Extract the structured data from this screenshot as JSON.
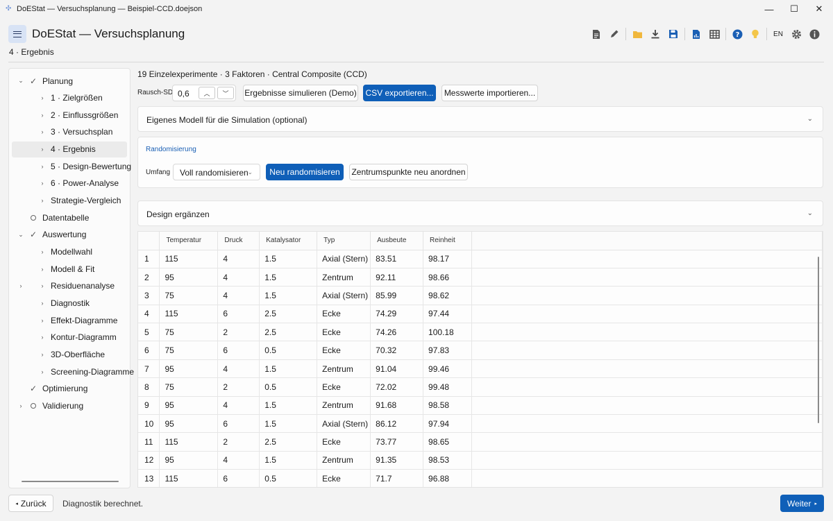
{
  "window": {
    "title": "DoEStat — Versuchsplanung — Beispiel-CCD.doejson",
    "minimize": "—",
    "maximize": "☐",
    "close": "✕"
  },
  "header": {
    "title": "DoEStat — Versuchsplanung",
    "lang": "EN",
    "breadcrumb": "4 · Ergebnis",
    "icons": [
      "document-icon",
      "edit-icon",
      "folder-icon",
      "download-icon",
      "save-icon",
      "report-icon",
      "table-icon",
      "help-icon",
      "lightbulb-icon",
      "settings-icon",
      "info-icon"
    ]
  },
  "sidebar": {
    "items": [
      {
        "label": "Planung",
        "level": 0,
        "state": "check",
        "expander": "⌄"
      },
      {
        "label": "1 · Zielgrößen",
        "level": 1
      },
      {
        "label": "2 · Einflussgrößen",
        "level": 1
      },
      {
        "label": "3 · Versuchsplan",
        "level": 1
      },
      {
        "label": "4 · Ergebnis",
        "level": 1,
        "selected": true
      },
      {
        "label": "5 · Design-Bewertung",
        "level": 1
      },
      {
        "label": "6 · Power-Analyse",
        "level": 1
      },
      {
        "label": "Strategie-Vergleich",
        "level": 1
      },
      {
        "label": "Datentabelle",
        "level": 0,
        "state": "circle"
      },
      {
        "label": "Auswertung",
        "level": 0,
        "state": "check",
        "expander": "⌄"
      },
      {
        "label": "Modellwahl",
        "level": 1
      },
      {
        "label": "Modell & Fit",
        "level": 1
      },
      {
        "label": "Residuenanalyse",
        "level": 1,
        "expander": "›"
      },
      {
        "label": "Diagnostik",
        "level": 1
      },
      {
        "label": "Effekt-Diagramme",
        "level": 1
      },
      {
        "label": "Kontur-Diagramm",
        "level": 1
      },
      {
        "label": "3D-Oberfläche",
        "level": 1
      },
      {
        "label": "Screening-Diagramme",
        "level": 1
      },
      {
        "label": "Optimierung",
        "level": 0,
        "state": "check"
      },
      {
        "label": "Validierung",
        "level": 0,
        "state": "circle",
        "expander": "›"
      }
    ]
  },
  "main": {
    "summary": "19 Einzelexperimente · 3 Faktoren · Central Composite (CCD)",
    "noise_label": "Rausch-SD",
    "noise_value": "0,6",
    "simulate_button": "Ergebnisse simulieren (Demo)",
    "export_button": "CSV exportieren...",
    "import_button": "Messwerte importieren...",
    "custom_model_title": "Eigenes Modell für die Simulation (optional)",
    "randomization": {
      "title": "Randomisierung",
      "scope_label": "Umfang",
      "scope_value": "Voll randomisieren",
      "rerandomize_button": "Neu randomisieren",
      "reorder_center_button": "Zentrumspunkte neu anordnen"
    },
    "augment_title": "Design ergänzen"
  },
  "table": {
    "columns": [
      "",
      "Temperatur",
      "Druck",
      "Katalysator",
      "Typ",
      "Ausbeute",
      "Reinheit"
    ],
    "rows": [
      [
        "1",
        "115",
        "4",
        "1.5",
        "Axial (Stern)",
        "83.51",
        "98.17"
      ],
      [
        "2",
        "95",
        "4",
        "1.5",
        "Zentrum",
        "92.11",
        "98.66"
      ],
      [
        "3",
        "75",
        "4",
        "1.5",
        "Axial (Stern)",
        "85.99",
        "98.62"
      ],
      [
        "4",
        "115",
        "6",
        "2.5",
        "Ecke",
        "74.29",
        "97.44"
      ],
      [
        "5",
        "75",
        "2",
        "2.5",
        "Ecke",
        "74.26",
        "100.18"
      ],
      [
        "6",
        "75",
        "6",
        "0.5",
        "Ecke",
        "70.32",
        "97.83"
      ],
      [
        "7",
        "95",
        "4",
        "1.5",
        "Zentrum",
        "91.04",
        "99.46"
      ],
      [
        "8",
        "75",
        "2",
        "0.5",
        "Ecke",
        "72.02",
        "99.48"
      ],
      [
        "9",
        "95",
        "4",
        "1.5",
        "Zentrum",
        "91.68",
        "98.58"
      ],
      [
        "10",
        "95",
        "6",
        "1.5",
        "Axial (Stern)",
        "86.12",
        "97.94"
      ],
      [
        "11",
        "115",
        "2",
        "2.5",
        "Ecke",
        "73.77",
        "98.65"
      ],
      [
        "12",
        "95",
        "4",
        "1.5",
        "Zentrum",
        "91.35",
        "98.53"
      ],
      [
        "13",
        "115",
        "6",
        "0.5",
        "Ecke",
        "71.7",
        "96.88"
      ]
    ]
  },
  "footer": {
    "back_label": "Zurück",
    "status": "Diagnostik berechnet.",
    "next_label": "Weiter"
  },
  "colors": {
    "accent": "#0f5fb8",
    "folder": "#f0b73c",
    "bulb": "#f3c649",
    "help": "#1a5fb4"
  }
}
